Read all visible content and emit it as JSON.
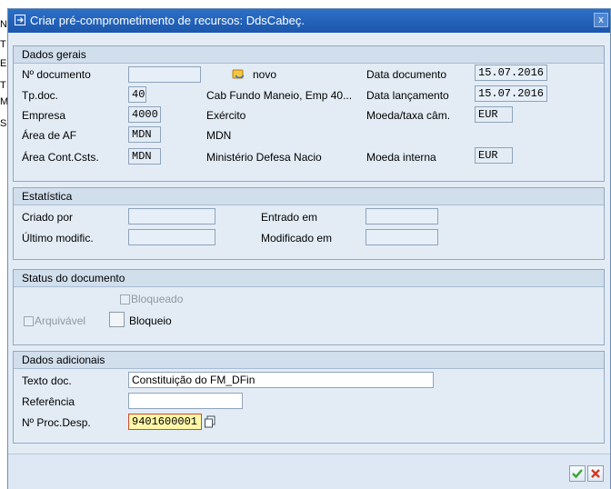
{
  "background_left_chars": [
    "N",
    "T",
    "E",
    "T",
    "M",
    "S"
  ],
  "window": {
    "title": "Criar pré-comprometimento de recursos: DdsCabeç.",
    "close_glyph": "x"
  },
  "dados_gerais": {
    "title": "Dados gerais",
    "n_documento_label": "Nº documento",
    "n_documento_value": "",
    "novo_label": "novo",
    "data_documento_label": "Data documento",
    "data_documento_value": "15.07.2016",
    "tp_doc_label": "Tp.doc.",
    "tp_doc_value": "40",
    "tp_doc_desc": "Cab Fundo Maneio, Emp 40...",
    "data_lancamento_label": "Data lançamento",
    "data_lancamento_value": "15.07.2016",
    "empresa_label": "Empresa",
    "empresa_value": "4000",
    "exercicio_label": "Exército",
    "moeda_taxa_label": "Moeda/taxa câm.",
    "moeda_taxa_value": "EUR",
    "area_af_label": "Área de AF",
    "area_af_value": "MDN",
    "area_af_desc": "MDN",
    "area_cont_label": "Área Cont.Csts.",
    "area_cont_value": "MDN",
    "area_cont_desc": "Ministério Defesa Nacio",
    "moeda_interna_label": "Moeda interna",
    "moeda_interna_value": "EUR"
  },
  "estatistica": {
    "title": "Estatística",
    "criado_por_label": "Criado por",
    "criado_por_value": "",
    "entrado_em_label": "Entrado em",
    "entrado_em_value": "",
    "ultimo_modific_label": "Último modific.",
    "ultimo_modific_value": "",
    "modificado_em_label": "Modificado em",
    "modificado_em_value": ""
  },
  "status_documento": {
    "title": "Status do documento",
    "bloqueado_label": "Bloqueado",
    "bloqueado_checked": false,
    "arquivavel_label": "Arquivável",
    "arquivavel_checked": false,
    "bloqueio_label": "Bloqueio",
    "bloqueio_checked": false
  },
  "dados_adicionais": {
    "title": "Dados adicionais",
    "texto_doc_label": "Texto doc.",
    "texto_doc_value": "Constituição do FM_DFin",
    "referencia_label": "Referência",
    "referencia_value": "",
    "n_proc_desp_label": "Nº Proc.Desp.",
    "n_proc_desp_value": "9401600001"
  },
  "colors": {
    "titlebar": "#1b57ad",
    "dialog_bg": "#e3ecf5",
    "active_field_bg": "#fff7a8",
    "active_field_border": "#d24a2a",
    "ok_green": "#3aa335",
    "cancel_red": "#d23a22"
  },
  "icons": {
    "title": "window-icon",
    "novo": "new-document-icon",
    "proc_desp": "copy-icon",
    "ok": "checkmark-icon",
    "cancel": "cancel-x-icon"
  }
}
